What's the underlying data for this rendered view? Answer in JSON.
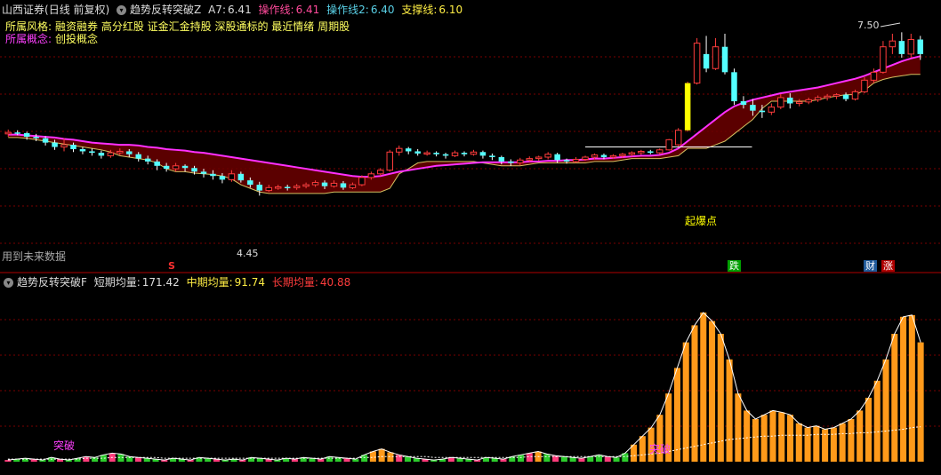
{
  "header": {
    "broker": "山西证券",
    "mode": "(日线 前复权)",
    "indicator": "趋势反转突破Z",
    "a7_label": "A7:",
    "a7_value": "6.41",
    "op_label": "操作线:",
    "op_value": "6.41",
    "op2_label": "操作线2:",
    "op2_value": "6.40",
    "support_label": "支撑线:",
    "support_value": "6.10"
  },
  "style_line": {
    "label": "所属风格:",
    "items": "融资融券 高分红股 证金汇金持股 深股通标的 最近情绪 周期股"
  },
  "concept_line": {
    "label": "所属概念:",
    "items": "创投概念"
  },
  "future_note": "用到未来数据",
  "annotations": {
    "high_price": "7.50",
    "low_price": "4.45",
    "start_point": "起爆点",
    "marker_s": "S",
    "marker_die": "跌",
    "marker_cai": "财",
    "marker_zhang": "涨",
    "breakout_1": "突破",
    "breakout_2": "突破"
  },
  "bottom_header": {
    "indicator": "趋势反转突破F",
    "short_label": "短期均量:",
    "short_value": "171.42",
    "mid_label": "中期均量:",
    "mid_value": "91.74",
    "long_label": "长期均量:",
    "long_value": "40.88"
  },
  "colors": {
    "up": "#ff3c3c",
    "down": "#54ffff",
    "magenta": "#ff30ff",
    "yellow": "#ffff00",
    "orange": "#ff9a1a",
    "cloud": "#6b0000",
    "grid": "#7a0000"
  },
  "chart_data": [
    {
      "type": "candlestick",
      "title": "趋势反转突破Z",
      "ylim": [
        4.3,
        7.7
      ],
      "candles": [
        [
          6.1,
          6.12,
          6.16,
          6.06
        ],
        [
          6.12,
          6.11,
          6.15,
          6.08
        ],
        [
          6.11,
          6.06,
          6.13,
          6.02
        ],
        [
          6.06,
          6.04,
          6.1,
          6.0
        ],
        [
          6.04,
          5.98,
          6.07,
          5.94
        ],
        [
          5.98,
          5.92,
          6.02,
          5.88
        ],
        [
          5.92,
          5.95,
          6.04,
          5.86
        ],
        [
          5.95,
          5.89,
          5.98,
          5.85
        ],
        [
          5.89,
          5.86,
          5.92,
          5.82
        ],
        [
          5.86,
          5.84,
          5.9,
          5.8
        ],
        [
          5.84,
          5.8,
          5.87,
          5.76
        ],
        [
          5.8,
          5.84,
          5.88,
          5.77
        ],
        [
          5.84,
          5.86,
          5.9,
          5.81
        ],
        [
          5.86,
          5.82,
          5.89,
          5.78
        ],
        [
          5.82,
          5.76,
          5.85,
          5.72
        ],
        [
          5.76,
          5.72,
          5.8,
          5.68
        ],
        [
          5.72,
          5.66,
          5.75,
          5.6
        ],
        [
          5.66,
          5.62,
          5.7,
          5.58
        ],
        [
          5.62,
          5.66,
          5.7,
          5.58
        ],
        [
          5.66,
          5.63,
          5.68,
          5.58
        ],
        [
          5.63,
          5.58,
          5.66,
          5.54
        ],
        [
          5.58,
          5.55,
          5.62,
          5.5
        ],
        [
          5.55,
          5.52,
          5.6,
          5.47
        ],
        [
          5.52,
          5.47,
          5.56,
          5.42
        ],
        [
          5.47,
          5.55,
          5.6,
          5.44
        ],
        [
          5.55,
          5.46,
          5.58,
          5.43
        ],
        [
          5.46,
          5.4,
          5.5,
          5.36
        ],
        [
          5.4,
          5.32,
          5.44,
          5.25
        ],
        [
          5.32,
          5.36,
          5.4,
          5.3
        ],
        [
          5.36,
          5.37,
          5.4,
          5.33
        ],
        [
          5.37,
          5.36,
          5.4,
          5.32
        ],
        [
          5.36,
          5.38,
          5.41,
          5.33
        ],
        [
          5.38,
          5.4,
          5.43,
          5.35
        ],
        [
          5.4,
          5.43,
          5.46,
          5.37
        ],
        [
          5.43,
          5.38,
          5.46,
          5.34
        ],
        [
          5.38,
          5.42,
          5.46,
          5.36
        ],
        [
          5.42,
          5.36,
          5.45,
          5.33
        ],
        [
          5.36,
          5.4,
          5.43,
          5.34
        ],
        [
          5.4,
          5.5,
          5.53,
          5.38
        ],
        [
          5.5,
          5.55,
          5.58,
          5.47
        ],
        [
          5.55,
          5.6,
          5.63,
          5.52
        ],
        [
          5.6,
          5.85,
          5.88,
          5.58
        ],
        [
          5.85,
          5.9,
          5.94,
          5.8
        ],
        [
          5.9,
          5.86,
          5.92,
          5.82
        ],
        [
          5.86,
          5.83,
          5.89,
          5.8
        ],
        [
          5.83,
          5.84,
          5.87,
          5.8
        ],
        [
          5.84,
          5.82,
          5.86,
          5.79
        ],
        [
          5.82,
          5.8,
          5.84,
          5.76
        ],
        [
          5.8,
          5.84,
          5.87,
          5.78
        ],
        [
          5.84,
          5.82,
          5.86,
          5.79
        ],
        [
          5.82,
          5.85,
          5.88,
          5.8
        ],
        [
          5.85,
          5.8,
          5.87,
          5.76
        ],
        [
          5.8,
          5.78,
          5.83,
          5.74
        ],
        [
          5.78,
          5.72,
          5.8,
          5.68
        ],
        [
          5.72,
          5.7,
          5.75,
          5.66
        ],
        [
          5.7,
          5.74,
          5.77,
          5.67
        ],
        [
          5.74,
          5.76,
          5.79,
          5.72
        ],
        [
          5.76,
          5.78,
          5.8,
          5.73
        ],
        [
          5.78,
          5.82,
          5.85,
          5.75
        ],
        [
          5.82,
          5.74,
          5.84,
          5.7
        ],
        [
          5.74,
          5.72,
          5.76,
          5.69
        ],
        [
          5.72,
          5.75,
          5.78,
          5.7
        ],
        [
          5.75,
          5.78,
          5.8,
          5.73
        ],
        [
          5.78,
          5.81,
          5.83,
          5.75
        ],
        [
          5.81,
          5.78,
          5.83,
          5.75
        ],
        [
          5.78,
          5.8,
          5.82,
          5.76
        ],
        [
          5.8,
          5.82,
          5.84,
          5.77
        ],
        [
          5.82,
          5.84,
          5.86,
          5.79
        ],
        [
          5.84,
          5.86,
          5.88,
          5.81
        ],
        [
          5.86,
          5.84,
          5.88,
          5.82
        ],
        [
          5.84,
          5.88,
          5.9,
          5.82
        ],
        [
          5.88,
          6.02,
          6.03,
          5.87
        ],
        [
          5.95,
          6.15,
          6.18,
          5.93
        ],
        [
          6.15,
          6.8,
          6.82,
          6.13
        ],
        [
          6.8,
          7.35,
          7.42,
          6.78
        ],
        [
          7.2,
          7.0,
          7.45,
          6.95
        ],
        [
          7.0,
          7.3,
          7.42,
          6.98
        ],
        [
          7.3,
          6.95,
          7.48,
          6.92
        ],
        [
          6.95,
          6.55,
          7.0,
          6.5
        ],
        [
          6.55,
          6.5,
          6.62,
          6.45
        ],
        [
          6.5,
          6.42,
          6.58,
          6.35
        ],
        [
          6.42,
          6.4,
          6.5,
          6.32
        ],
        [
          6.4,
          6.47,
          6.52,
          6.36
        ],
        [
          6.47,
          6.6,
          6.65,
          6.44
        ],
        [
          6.6,
          6.52,
          6.66,
          6.45
        ],
        [
          6.52,
          6.54,
          6.58,
          6.48
        ],
        [
          6.54,
          6.57,
          6.6,
          6.51
        ],
        [
          6.57,
          6.6,
          6.63,
          6.54
        ],
        [
          6.6,
          6.62,
          6.65,
          6.56
        ],
        [
          6.62,
          6.64,
          6.66,
          6.58
        ],
        [
          6.64,
          6.58,
          6.67,
          6.55
        ],
        [
          6.58,
          6.68,
          6.71,
          6.56
        ],
        [
          6.68,
          6.84,
          6.88,
          6.66
        ],
        [
          6.84,
          6.95,
          7.0,
          6.8
        ],
        [
          6.95,
          7.3,
          7.38,
          6.93
        ],
        [
          7.3,
          7.38,
          7.48,
          7.2
        ],
        [
          7.38,
          7.2,
          7.5,
          7.15
        ],
        [
          7.2,
          7.4,
          7.48,
          7.15
        ],
        [
          7.4,
          7.2,
          7.45,
          7.12
        ]
      ],
      "ma_line": [
        6.09,
        6.09,
        6.08,
        6.07,
        6.06,
        6.05,
        6.03,
        6.02,
        6.0,
        5.98,
        5.97,
        5.96,
        5.95,
        5.95,
        5.94,
        5.92,
        5.91,
        5.89,
        5.88,
        5.87,
        5.85,
        5.84,
        5.82,
        5.8,
        5.78,
        5.76,
        5.74,
        5.72,
        5.7,
        5.68,
        5.66,
        5.64,
        5.62,
        5.6,
        5.58,
        5.56,
        5.54,
        5.52,
        5.51,
        5.51,
        5.52,
        5.55,
        5.58,
        5.6,
        5.62,
        5.64,
        5.66,
        5.67,
        5.68,
        5.69,
        5.7,
        5.71,
        5.71,
        5.71,
        5.71,
        5.71,
        5.72,
        5.72,
        5.73,
        5.73,
        5.74,
        5.74,
        5.75,
        5.76,
        5.76,
        5.77,
        5.78,
        5.79,
        5.8,
        5.8,
        5.81,
        5.84,
        5.9,
        6.0,
        6.1,
        6.2,
        6.3,
        6.4,
        6.48,
        6.53,
        6.57,
        6.6,
        6.63,
        6.66,
        6.68,
        6.7,
        6.72,
        6.74,
        6.77,
        6.8,
        6.83,
        6.86,
        6.9,
        6.95,
        7.0,
        7.05,
        7.1,
        7.14,
        7.17
      ],
      "support_line": [
        6.05,
        6.05,
        6.04,
        6.02,
        6.0,
        5.98,
        5.96,
        5.94,
        5.92,
        5.9,
        5.88,
        5.85,
        5.8,
        5.78,
        5.76,
        5.74,
        5.7,
        5.62,
        5.58,
        5.58,
        5.56,
        5.55,
        5.54,
        5.52,
        5.48,
        5.4,
        5.35,
        5.3,
        5.28,
        5.28,
        5.28,
        5.28,
        5.28,
        5.28,
        5.28,
        5.3,
        5.3,
        5.3,
        5.3,
        5.3,
        5.3,
        5.35,
        5.55,
        5.62,
        5.7,
        5.72,
        5.72,
        5.72,
        5.72,
        5.72,
        5.72,
        5.7,
        5.68,
        5.66,
        5.66,
        5.66,
        5.68,
        5.7,
        5.7,
        5.7,
        5.7,
        5.7,
        5.7,
        5.72,
        5.72,
        5.72,
        5.74,
        5.76,
        5.76,
        5.76,
        5.76,
        5.78,
        5.8,
        5.9,
        5.9,
        5.9,
        5.95,
        6.0,
        6.1,
        6.2,
        6.3,
        6.45,
        6.55,
        6.55,
        6.55,
        6.55,
        6.55,
        6.57,
        6.6,
        6.62,
        6.64,
        6.64,
        6.7,
        6.8,
        6.85,
        6.88,
        6.9,
        6.92,
        6.92
      ]
    },
    {
      "type": "bar",
      "title": "趋势反转突破F",
      "ylim": [
        0,
        200
      ],
      "bars": [
        2,
        3,
        4,
        3,
        2,
        5,
        3,
        2,
        4,
        6,
        5,
        8,
        10,
        9,
        6,
        5,
        4,
        3,
        2,
        4,
        3,
        2,
        5,
        4,
        3,
        2,
        3,
        2,
        5,
        4,
        3,
        2,
        4,
        3,
        5,
        4,
        3,
        6,
        5,
        4,
        3,
        8,
        12,
        15,
        11,
        8,
        6,
        4,
        3,
        2,
        3,
        5,
        4,
        3,
        2,
        5,
        4,
        3,
        6,
        8,
        10,
        12,
        9,
        7,
        6,
        5,
        4,
        6,
        8,
        6,
        5,
        10,
        20,
        30,
        40,
        55,
        80,
        110,
        140,
        160,
        175,
        165,
        150,
        120,
        80,
        60,
        50,
        55,
        60,
        58,
        55,
        45,
        40,
        42,
        38,
        40,
        45,
        50,
        60,
        75,
        95,
        120,
        150,
        170,
        172,
        140
      ],
      "avg_line": [
        3,
        3,
        3,
        3,
        3,
        3,
        3,
        3,
        3,
        4,
        4,
        4,
        5,
        5,
        5,
        5,
        5,
        5,
        4,
        4,
        4,
        4,
        4,
        4,
        4,
        4,
        4,
        4,
        4,
        4,
        4,
        4,
        4,
        4,
        4,
        4,
        4,
        4,
        4,
        4,
        4,
        5,
        5,
        6,
        6,
        6,
        6,
        6,
        6,
        5,
        5,
        5,
        5,
        5,
        5,
        5,
        5,
        5,
        5,
        5,
        6,
        6,
        6,
        6,
        6,
        6,
        6,
        6,
        6,
        6,
        6,
        6,
        7,
        8,
        9,
        10,
        12,
        14,
        16,
        18,
        20,
        22,
        24,
        26,
        27,
        28,
        29,
        30,
        30,
        31,
        31,
        31,
        31,
        32,
        32,
        32,
        33,
        33,
        34,
        34,
        35,
        36,
        37,
        38,
        40,
        41
      ]
    }
  ]
}
